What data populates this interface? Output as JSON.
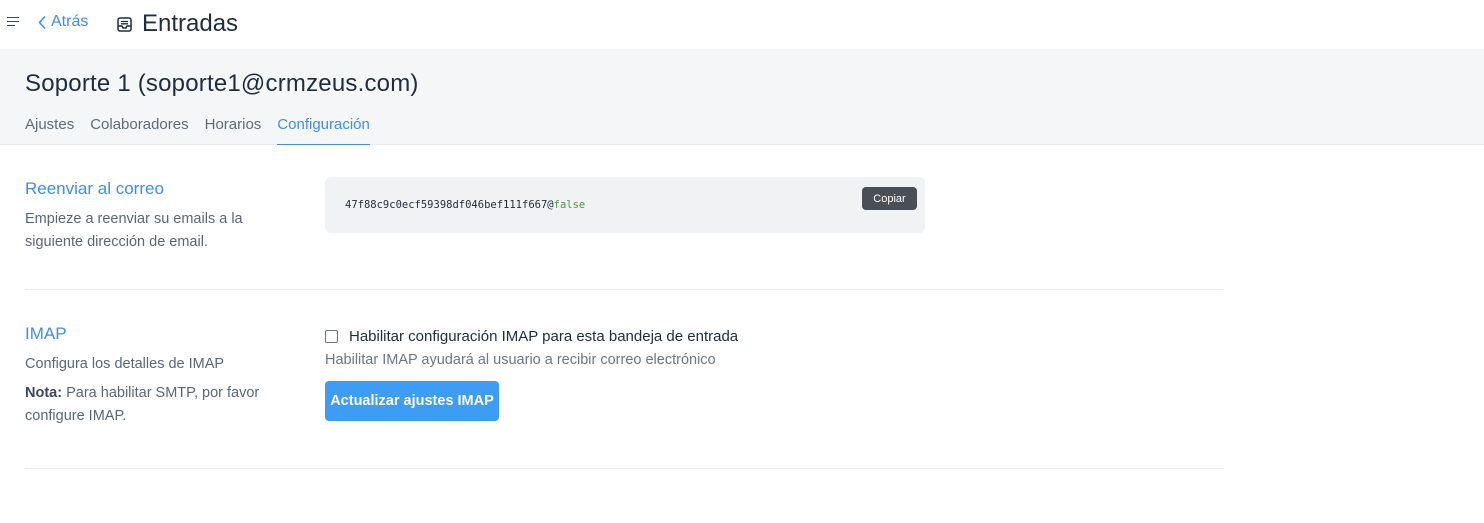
{
  "topbar": {
    "menu_icon": "hamburger-menu-icon",
    "back_label": "Atrás",
    "back_icon": "chevron-left-icon",
    "page_icon": "inbox-icon",
    "page_title": "Entradas"
  },
  "inbox": {
    "name": "Soporte 1 (soporte1@crmzeus.com)"
  },
  "tabs": [
    {
      "label": "Ajustes",
      "active": false
    },
    {
      "label": "Colaboradores",
      "active": false
    },
    {
      "label": "Horarios",
      "active": false
    },
    {
      "label": "Configuración",
      "active": true
    }
  ],
  "forward": {
    "title": "Reenviar al correo",
    "description": "Empieze a reenviar su emails a la siguiente dirección de email.",
    "address_prefix": "47f88c9c0ecf59398df046bef111f667@",
    "address_suffix": "false",
    "copy_label": "Copiar"
  },
  "imap": {
    "title": "IMAP",
    "description": "Configura los detalles de IMAP",
    "note_label": "Nota:",
    "note_text": "Para habilitar SMTP, por favor configure IMAP.",
    "checkbox_label": "Habilitar configuración IMAP para esta bandeja de entrada",
    "checkbox_checked": false,
    "help_text": "Habilitar IMAP ayudará al usuario a recibir correo electrónico",
    "update_button": "Actualizar ajustes IMAP"
  },
  "colors": {
    "accent": "#3d8fe8",
    "primary_button": "#3d9cf4",
    "band_bg": "#f5f6f8"
  }
}
